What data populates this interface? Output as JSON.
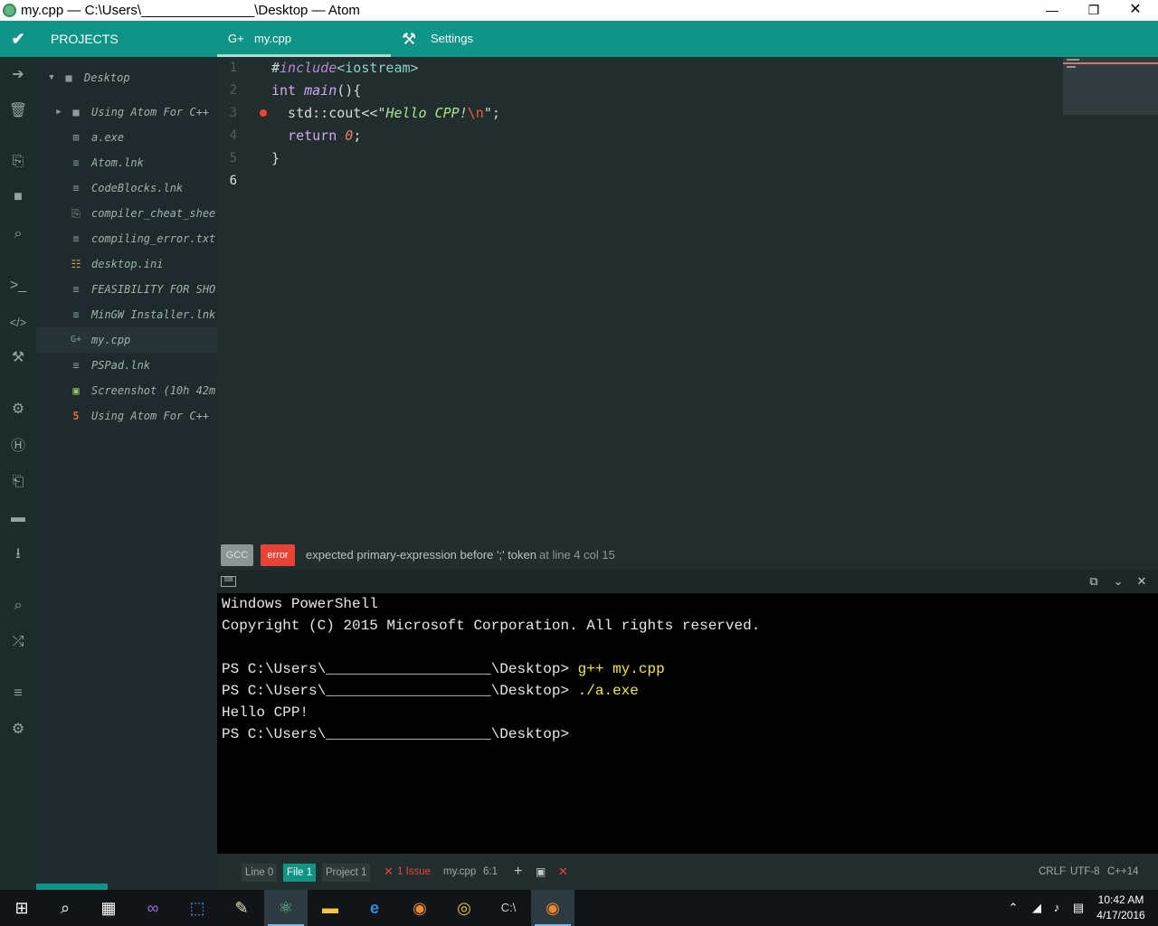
{
  "window": {
    "title": "my.cpp — C:\\Users\\_______________\\Desktop — Atom",
    "minimize_icon": "minimize-icon",
    "restore_icon": "restore-icon",
    "close_icon": "close-icon"
  },
  "tabbar": {
    "projects_label": "PROJECTS",
    "tabs": [
      {
        "label": "my.cpp",
        "icon": "cpp-file-icon"
      },
      {
        "label": "Settings",
        "icon": "tools-icon"
      }
    ]
  },
  "tree": {
    "root": "Desktop",
    "items": [
      {
        "label": "Using Atom For C++",
        "icon": "folder-icon"
      },
      {
        "label": "a.exe",
        "icon": "windows-icon"
      },
      {
        "label": "Atom.lnk",
        "icon": "file-icon"
      },
      {
        "label": "CodeBlocks.lnk",
        "icon": "file-icon"
      },
      {
        "label": "compiler_cheat_shee",
        "icon": "pdf-icon"
      },
      {
        "label": "compiling_error.txt",
        "icon": "file-icon"
      },
      {
        "label": "desktop.ini",
        "icon": "config-icon"
      },
      {
        "label": "FEASIBILITY FOR SHO",
        "icon": "file-icon"
      },
      {
        "label": "MinGW Installer.lnk",
        "icon": "file-icon"
      },
      {
        "label": "my.cpp",
        "icon": "cpp-file-icon"
      },
      {
        "label": "PSPad.lnk",
        "icon": "file-icon"
      },
      {
        "label": "Screenshot (10h 42m",
        "icon": "image-icon"
      },
      {
        "label": "Using Atom For C++",
        "icon": "html5-icon"
      }
    ]
  },
  "editor": {
    "line_numbers": [
      "1",
      "2",
      "3",
      "4",
      "5",
      "6"
    ],
    "lines": [
      {
        "a": "#",
        "b": "include",
        "c": "<iostream>"
      },
      {
        "a": "int",
        "b": " main",
        "c": "(){"
      },
      {
        "a": "  std::cout<<\"",
        "b": "Hello CPP!",
        "c": "\\n",
        "d": "\";"
      },
      {
        "a": "  return",
        "b": " 0",
        "c": ";"
      },
      {
        "a": "}"
      }
    ]
  },
  "linter": {
    "source": "GCC",
    "severity": "error",
    "message": "expected primary-expression before ';' token",
    "position": "at line 4 col 15"
  },
  "terminal": {
    "lines": [
      "Windows PowerShell",
      "Copyright (C) 2015 Microsoft Corporation. All rights reserved.",
      "",
      "PS C:\\Users\\___________________\\Desktop> ",
      "PS C:\\Users\\___________________\\Desktop> ",
      "Hello CPP!",
      "PS C:\\Users\\___________________\\Desktop>"
    ],
    "commands": [
      "g++ my.cpp",
      "./a.exe"
    ]
  },
  "statusbar": {
    "line": "Line 0",
    "file": "File 1",
    "project": "Project 1",
    "issues": "1 Issue",
    "filename": "my.cpp",
    "cursor": "6:1",
    "line_ending": "CRLF",
    "encoding": "UTF-8",
    "grammar": "C++14"
  },
  "clock": {
    "time": "10:42 AM",
    "date": "4/17/2016"
  },
  "colors": {
    "accent": "#0f9488",
    "error": "#ea4336"
  }
}
